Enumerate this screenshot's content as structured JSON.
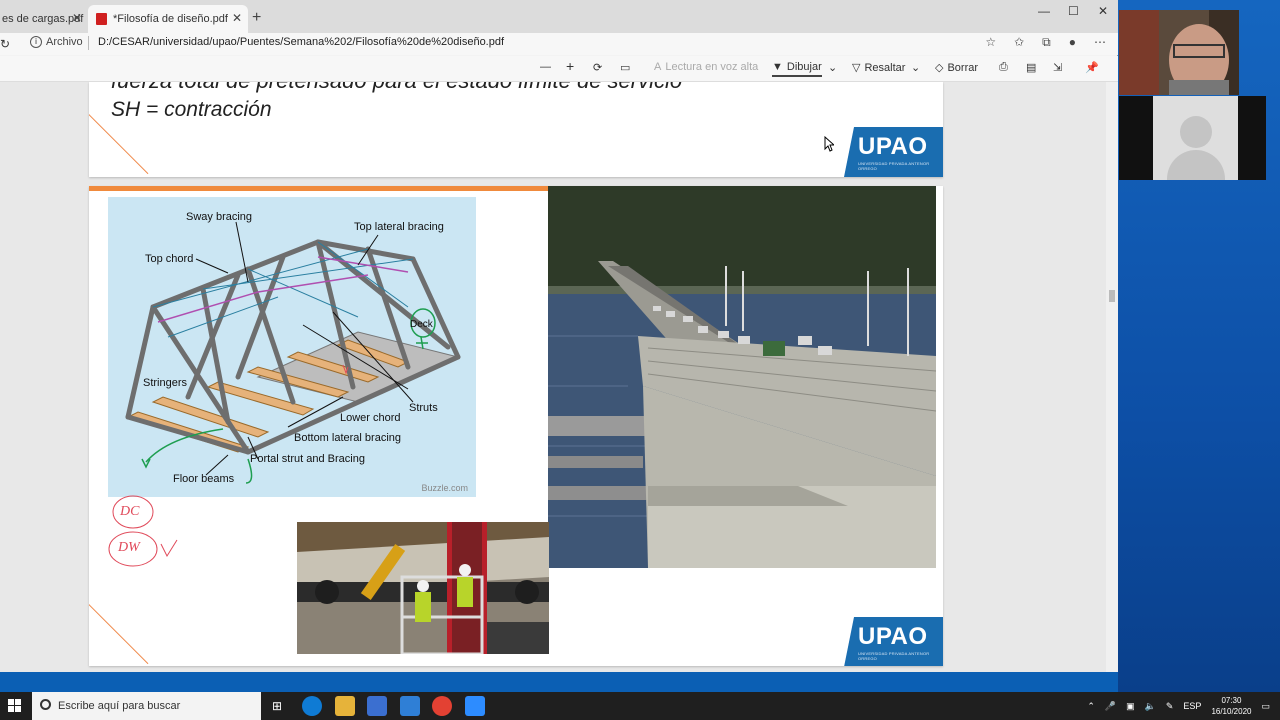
{
  "browser": {
    "tabs": [
      {
        "label": "es de cargas.pdf"
      },
      {
        "label": "*Filosofía de diseño.pdf"
      }
    ],
    "address": {
      "label": "Archivo",
      "url": "D:/CESAR/universidad/upao/Puentes/Semana%202/Filosofía%20de%20diseño.pdf"
    }
  },
  "pdf_toolbar": {
    "zoom_out": "—",
    "zoom_in": "+",
    "read_aloud": "Lectura en voz alta",
    "draw": "Dibujar",
    "highlight": "Resaltar",
    "erase": "Borrar"
  },
  "slide1": {
    "line1": "fuerza total de pretensado para el estado límite de servicio",
    "line2": "SH = contracción"
  },
  "logo": {
    "text": "UPAO",
    "subtext": "UNIVERSIDAD PRIVADA ANTENOR ORREGO"
  },
  "slide2": {
    "truss_labels": {
      "sway": "Sway bracing",
      "top_lateral": "Top lateral bracing",
      "top_chord": "Top chord",
      "deck": "Deck",
      "stringers": "Stringers",
      "struts": "Struts",
      "lower_chord": "Lower chord",
      "bottom_lateral": "Bottom lateral bracing",
      "portal": "Portal strut and Bracing",
      "floor_beams": "Floor beams",
      "credit": "Buzzle.com"
    },
    "ink": {
      "dc": "DC",
      "dw": "DW"
    }
  },
  "taskbar": {
    "search_placeholder": "Escribe aquí para buscar",
    "lang": "ESP",
    "time": "07:30",
    "date": "16/10/2020"
  },
  "colors": {
    "accent_blue": "#1a6db0",
    "slide_orange": "#f08a3c",
    "ink_red": "#e04a5a",
    "ink_green": "#1e9e50"
  }
}
